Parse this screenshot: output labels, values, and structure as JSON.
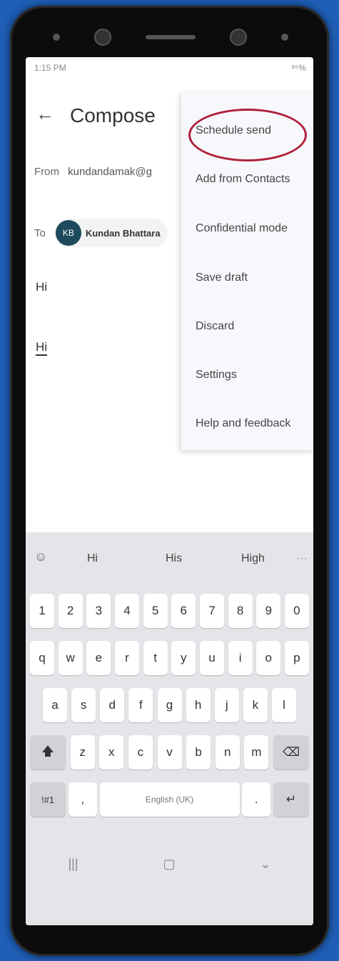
{
  "status_bar": {
    "time": "1:15 PM",
    "battery": "⁸⁵%"
  },
  "appbar": {
    "title": "Compose"
  },
  "from": {
    "label": "From",
    "address": "kundandamak@g"
  },
  "to": {
    "label": "To",
    "avatar_initials": "KB",
    "recipient": "Kundan Bhattara"
  },
  "body": {
    "line1": "Hi",
    "line2": "Hi"
  },
  "menu": {
    "items": [
      "Schedule send",
      "Add from Contacts",
      "Confidential mode",
      "Save draft",
      "Discard",
      "Settings",
      "Help and feedback"
    ],
    "highlight_color": "#b0203a"
  },
  "keyboard": {
    "suggestions": [
      "Hi",
      "His",
      "High"
    ],
    "more": "···",
    "row_numbers": [
      "1",
      "2",
      "3",
      "4",
      "5",
      "6",
      "7",
      "8",
      "9",
      "0"
    ],
    "row_q": [
      "q",
      "w",
      "e",
      "r",
      "t",
      "y",
      "u",
      "i",
      "o",
      "p"
    ],
    "row_a": [
      "a",
      "s",
      "d",
      "f",
      "g",
      "h",
      "j",
      "k",
      "l"
    ],
    "row_z": [
      "z",
      "x",
      "c",
      "v",
      "b",
      "n",
      "m"
    ],
    "symbols_key": "!#1",
    "comma_key": ",",
    "space_label": "English (UK)",
    "period_key": ".",
    "shift_icon": "shift-icon",
    "backspace_icon": "backspace-icon",
    "enter_icon": "enter-icon"
  },
  "navbar": {
    "recents": "|||",
    "home": "▢",
    "back": "⌄"
  }
}
